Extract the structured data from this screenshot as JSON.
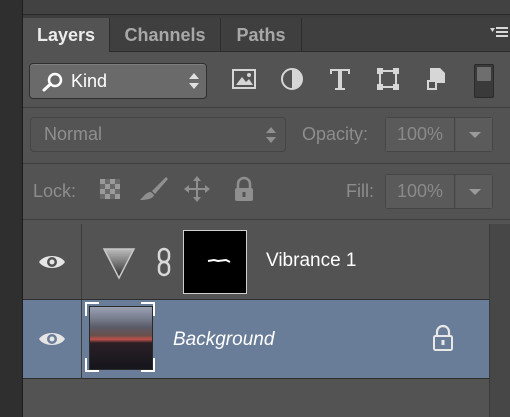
{
  "tabs": [
    {
      "label": "Layers",
      "active": true
    },
    {
      "label": "Channels",
      "active": false
    },
    {
      "label": "Paths",
      "active": false
    }
  ],
  "filter": {
    "kind_label": "Kind",
    "icons": [
      "pixel-filter-icon",
      "adjustment-filter-icon",
      "type-filter-icon",
      "shape-filter-icon",
      "smart-object-filter-icon",
      "filter-toggle-icon"
    ]
  },
  "blend": {
    "mode": "Normal",
    "opacity_label": "Opacity:",
    "opacity_value": "100%"
  },
  "lock": {
    "label": "Lock:",
    "fill_label": "Fill:",
    "fill_value": "100%"
  },
  "layers": [
    {
      "name": "Vibrance 1",
      "visible": true,
      "selected": false
    },
    {
      "name": "Background",
      "visible": true,
      "selected": true
    }
  ],
  "colors": {
    "panel_bg": "#535353",
    "selected_row": "#697c98"
  }
}
